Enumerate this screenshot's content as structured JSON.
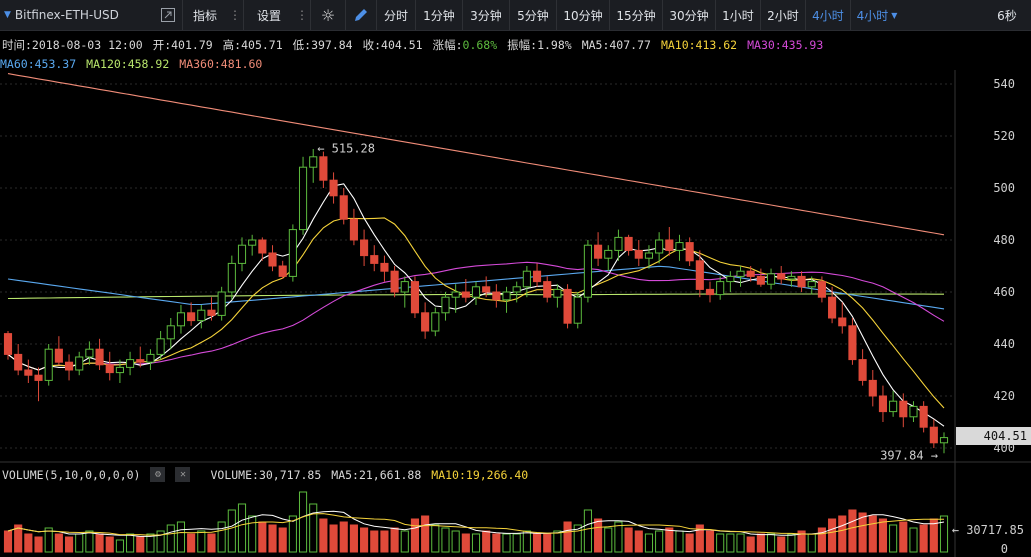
{
  "toolbar": {
    "symbol": "Bitfinex-ETH-USD",
    "indicators": "指标",
    "settings": "设置",
    "periods": [
      "分时",
      "1分钟",
      "3分钟",
      "5分钟",
      "10分钟",
      "15分钟",
      "30分钟",
      "1小时",
      "2小时",
      "4小时"
    ],
    "active_period": "4小时",
    "period_dropdown": "4小时",
    "refresh": "6秒"
  },
  "info": {
    "time": "时间:2018-08-03 12:00",
    "open": "开:401.79",
    "high": "高:405.71",
    "low": "低:397.84",
    "close": "收:404.51",
    "change": "涨幅:0.68%",
    "amplitude": "振幅:1.98%",
    "ma5": "MA5:407.77",
    "ma10": "MA10:413.62",
    "ma30": "MA30:435.93",
    "ma60": "MA60:453.37",
    "ma120": "MA120:458.92",
    "ma360": "MA360:481.60"
  },
  "volume_info": {
    "label": "VOLUME(5,10,0,0,0,0)",
    "volume": "VOLUME:30,717.85",
    "ma5": "MA5:21,661.88",
    "ma10": "MA10:19,266.40"
  },
  "colors": {
    "up": "#5dbb3e",
    "down": "#e04a3a",
    "ma5": "#ffffff",
    "ma10": "#f5d33a",
    "ma30": "#d44ad8",
    "ma60": "#5aa9f0",
    "ma120": "#b8e56c",
    "ma360": "#f08c78"
  },
  "chart_data": {
    "type": "candlestick",
    "y_ticks": [
      540,
      520,
      500,
      480,
      460,
      440,
      420,
      400
    ],
    "ylim": [
      400,
      549
    ],
    "current_price": "404.51",
    "high_annotation": "515.28",
    "low_annotation": "397.84",
    "volume_max_label": "30717.85",
    "volume_zero_label": "0",
    "candles": [
      [
        444,
        445,
        434,
        436
      ],
      [
        436,
        440,
        428,
        430
      ],
      [
        430,
        434,
        425,
        428
      ],
      [
        428,
        431,
        418,
        426
      ],
      [
        426,
        440,
        424,
        438
      ],
      [
        438,
        443,
        432,
        433
      ],
      [
        433,
        436,
        426,
        430
      ],
      [
        430,
        437,
        428,
        435
      ],
      [
        435,
        441,
        432,
        438
      ],
      [
        438,
        442,
        430,
        432
      ],
      [
        432,
        437,
        426,
        429
      ],
      [
        429,
        434,
        425,
        431
      ],
      [
        431,
        437,
        428,
        434
      ],
      [
        434,
        439,
        431,
        433
      ],
      [
        433,
        438,
        430,
        436
      ],
      [
        436,
        445,
        434,
        442
      ],
      [
        442,
        450,
        438,
        447
      ],
      [
        447,
        455,
        444,
        452
      ],
      [
        452,
        456,
        447,
        449
      ],
      [
        449,
        455,
        446,
        453
      ],
      [
        453,
        458,
        449,
        451
      ],
      [
        451,
        462,
        449,
        460
      ],
      [
        460,
        474,
        457,
        471
      ],
      [
        471,
        481,
        468,
        478
      ],
      [
        478,
        482,
        474,
        480
      ],
      [
        480,
        481,
        472,
        475
      ],
      [
        475,
        478,
        468,
        470
      ],
      [
        470,
        472,
        465,
        466
      ],
      [
        466,
        486,
        464,
        484
      ],
      [
        484,
        512,
        482,
        508
      ],
      [
        508,
        515,
        502,
        512
      ],
      [
        512,
        514,
        500,
        503
      ],
      [
        503,
        506,
        494,
        497
      ],
      [
        497,
        500,
        486,
        488
      ],
      [
        488,
        492,
        478,
        480
      ],
      [
        480,
        484,
        470,
        474
      ],
      [
        474,
        478,
        468,
        471
      ],
      [
        471,
        474,
        464,
        468
      ],
      [
        468,
        470,
        458,
        460
      ],
      [
        460,
        466,
        454,
        464
      ],
      [
        464,
        466,
        450,
        452
      ],
      [
        452,
        456,
        442,
        445
      ],
      [
        445,
        454,
        443,
        452
      ],
      [
        452,
        460,
        449,
        458
      ],
      [
        458,
        463,
        452,
        460
      ],
      [
        460,
        465,
        456,
        458
      ],
      [
        458,
        464,
        455,
        462
      ],
      [
        462,
        466,
        458,
        460
      ],
      [
        460,
        463,
        454,
        457
      ],
      [
        457,
        462,
        452,
        460
      ],
      [
        460,
        464,
        456,
        462
      ],
      [
        462,
        470,
        458,
        468
      ],
      [
        468,
        471,
        462,
        464
      ],
      [
        464,
        466,
        456,
        458
      ],
      [
        458,
        463,
        454,
        461
      ],
      [
        461,
        463,
        446,
        448
      ],
      [
        448,
        460,
        446,
        458
      ],
      [
        458,
        480,
        456,
        478
      ],
      [
        478,
        483,
        470,
        473
      ],
      [
        473,
        478,
        468,
        476
      ],
      [
        476,
        484,
        472,
        481
      ],
      [
        481,
        482,
        474,
        476
      ],
      [
        476,
        480,
        470,
        473
      ],
      [
        473,
        478,
        469,
        475
      ],
      [
        475,
        483,
        471,
        480
      ],
      [
        480,
        485,
        474,
        476
      ],
      [
        476,
        482,
        472,
        479
      ],
      [
        479,
        481,
        470,
        472
      ],
      [
        472,
        476,
        458,
        461
      ],
      [
        461,
        464,
        456,
        459
      ],
      [
        459,
        466,
        457,
        464
      ],
      [
        464,
        468,
        460,
        466
      ],
      [
        466,
        470,
        462,
        468
      ],
      [
        468,
        470,
        464,
        466
      ],
      [
        466,
        469,
        462,
        463
      ],
      [
        463,
        469,
        461,
        467
      ],
      [
        467,
        470,
        463,
        465
      ],
      [
        465,
        468,
        462,
        466
      ],
      [
        466,
        468,
        460,
        462
      ],
      [
        462,
        466,
        459,
        464
      ],
      [
        464,
        466,
        456,
        458
      ],
      [
        458,
        462,
        448,
        450
      ],
      [
        450,
        456,
        444,
        447
      ],
      [
        447,
        450,
        432,
        434
      ],
      [
        434,
        438,
        424,
        426
      ],
      [
        426,
        430,
        416,
        420
      ],
      [
        420,
        424,
        410,
        414
      ],
      [
        414,
        422,
        412,
        418
      ],
      [
        418,
        421,
        408,
        412
      ],
      [
        412,
        418,
        410,
        416
      ],
      [
        416,
        418,
        406,
        408
      ],
      [
        408,
        411,
        400,
        402
      ],
      [
        402,
        406,
        398,
        404
      ]
    ],
    "volumes": [
      0.35,
      0.45,
      0.3,
      0.25,
      0.4,
      0.3,
      0.25,
      0.3,
      0.35,
      0.3,
      0.25,
      0.2,
      0.3,
      0.25,
      0.3,
      0.35,
      0.45,
      0.5,
      0.3,
      0.35,
      0.3,
      0.5,
      0.7,
      0.8,
      0.6,
      0.5,
      0.45,
      0.4,
      0.6,
      1.0,
      0.8,
      0.55,
      0.45,
      0.5,
      0.45,
      0.4,
      0.35,
      0.35,
      0.4,
      0.35,
      0.55,
      0.6,
      0.45,
      0.4,
      0.35,
      0.3,
      0.3,
      0.35,
      0.3,
      0.3,
      0.3,
      0.35,
      0.3,
      0.3,
      0.35,
      0.5,
      0.45,
      0.7,
      0.55,
      0.4,
      0.5,
      0.4,
      0.35,
      0.3,
      0.35,
      0.4,
      0.35,
      0.3,
      0.45,
      0.35,
      0.3,
      0.3,
      0.3,
      0.25,
      0.3,
      0.3,
      0.25,
      0.3,
      0.35,
      0.3,
      0.4,
      0.55,
      0.6,
      0.7,
      0.65,
      0.6,
      0.55,
      0.45,
      0.5,
      0.4,
      0.45,
      0.55,
      0.6
    ]
  }
}
